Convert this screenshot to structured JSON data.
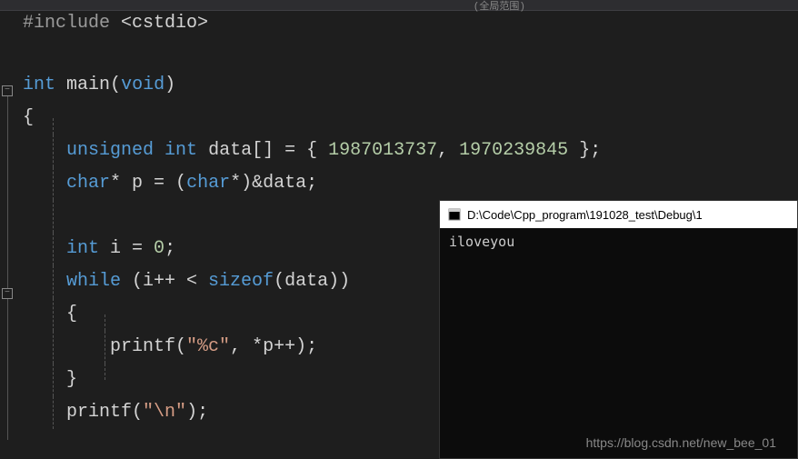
{
  "topBar": {
    "label": "(全局范围)"
  },
  "code": {
    "include": {
      "directive": "#include",
      "header": "<cstdio>"
    },
    "func_decl": {
      "ret_type": "int",
      "name": "main",
      "param_type": "void"
    },
    "decl1": {
      "qualifier": "unsigned",
      "type": "int",
      "name": "data[]",
      "eq": " = { ",
      "val1": "1987013737",
      "sep": ", ",
      "val2": "1970239845",
      "end": " };"
    },
    "decl2": {
      "type": "char",
      "ptr": "*",
      "name": " p = (",
      "cast_type": "char",
      "cast_end": "*)&data;"
    },
    "decl3": {
      "type": "int",
      "rest": " i = ",
      "val": "0",
      "semi": ";"
    },
    "while_stmt": {
      "kw": "while",
      "open": " (i++ < ",
      "sizeof": "sizeof",
      "close": "(data))"
    },
    "printf1": {
      "fn": "printf",
      "open": "(",
      "fmt": "\"%c\"",
      "rest": ", *p++);"
    },
    "printf2": {
      "fn": "printf",
      "open": "(",
      "fmt": "\"\\n\"",
      "close": ");"
    },
    "brace_open": "{",
    "brace_close": "}"
  },
  "console": {
    "title": "D:\\Code\\Cpp_program\\191028_test\\Debug\\1",
    "output": "iloveyou"
  },
  "watermark": "https://blog.csdn.net/new_bee_01",
  "foldMarkers": {
    "minus": "−"
  }
}
